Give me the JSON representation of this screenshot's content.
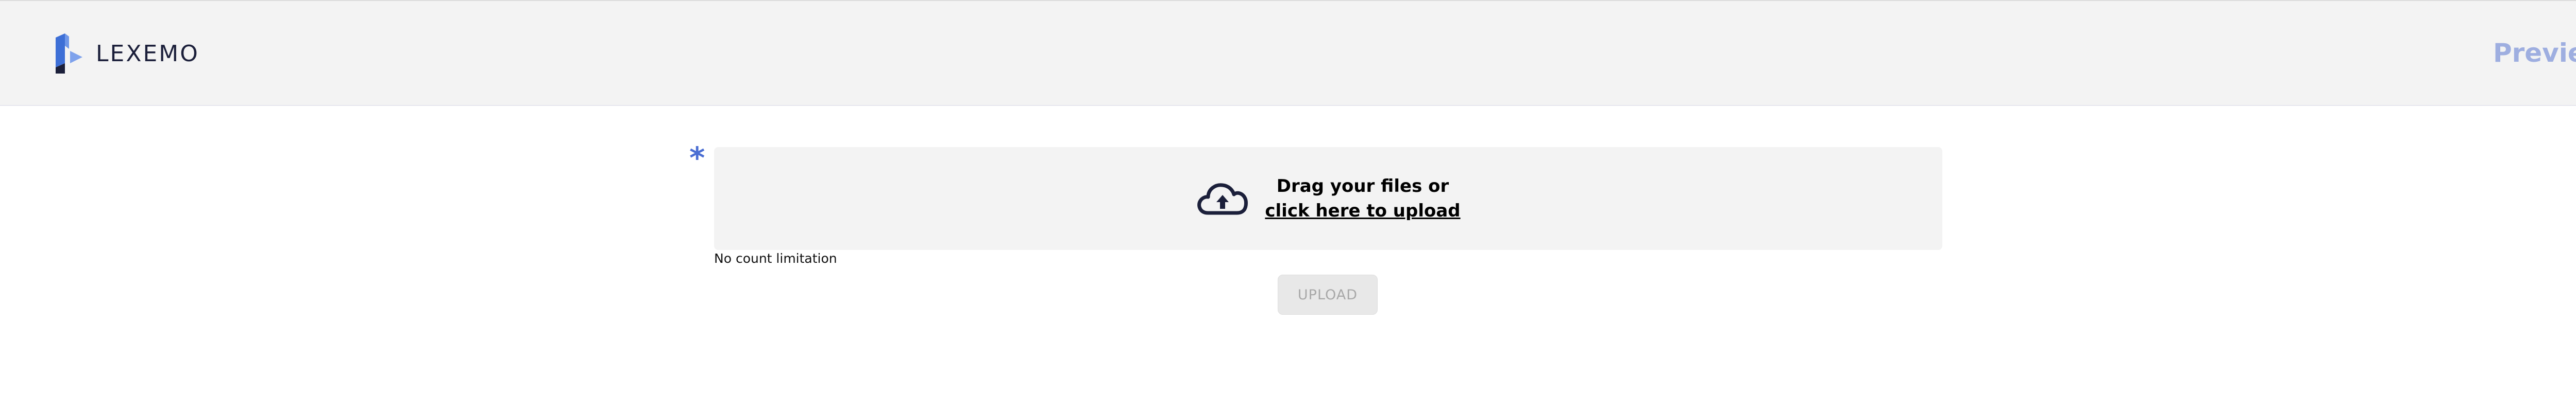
{
  "header": {
    "brand_name": "LEXEMO",
    "preview_label": "Preview"
  },
  "upload": {
    "required_marker": "*",
    "dropzone_line1": "Drag your files or",
    "dropzone_link": "click here to upload",
    "count_note": "No count limitation",
    "button_label": "UPLOAD",
    "button_enabled": false
  },
  "icons": {
    "logo": "lexemo-logo-icon",
    "upload": "cloud-upload-icon"
  },
  "colors": {
    "header_bg": "#f3f3f3",
    "brand_text": "#1b1f3a",
    "preview_link": "#9eaee0",
    "required_star": "#4a6ed3",
    "dropzone_bg": "#f3f3f3",
    "cloud_icon": "#1b1f3a",
    "button_bg": "#e8e8e8",
    "button_text": "#a8a8a8"
  }
}
